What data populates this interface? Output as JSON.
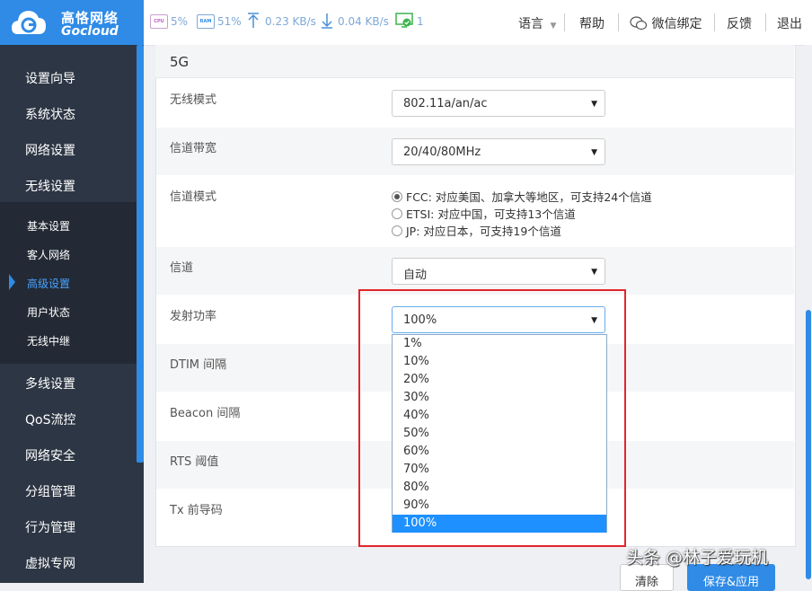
{
  "header": {
    "logo_cn": "高恪网络",
    "logo_en": "Gocloud",
    "cpu_label": "CPU",
    "cpu_value": "5%",
    "ram_label": "RAM",
    "ram_value": "51%",
    "upload": "0.23 KB/s",
    "download": "0.04 KB/s",
    "devices": "1",
    "menu": {
      "language": "语言",
      "help": "帮助",
      "wechat": "微信绑定",
      "feedback": "反馈",
      "logout": "退出"
    }
  },
  "sidebar": {
    "items": [
      "设置向导",
      "系统状态",
      "网络设置",
      "无线设置"
    ],
    "subitems": [
      "基本设置",
      "客人网络",
      "高级设置",
      "用户状态",
      "无线中继"
    ],
    "active_sub": "高级设置",
    "items_after": [
      "多线设置",
      "QoS流控",
      "网络安全",
      "分组管理",
      "行为管理",
      "虚拟专网"
    ]
  },
  "section": {
    "title": "5G",
    "rows": {
      "wireless_mode": {
        "label": "无线模式",
        "value": "802.11a/an/ac"
      },
      "bandwidth": {
        "label": "信道带宽",
        "value": "20/40/80MHz"
      },
      "channel_mode": {
        "label": "信道模式",
        "options": [
          {
            "text": "FCC: 对应美国、加拿大等地区，可支持24个信道",
            "checked": true
          },
          {
            "text": "ETSI: 对应中国，可支持13个信道",
            "checked": false
          },
          {
            "text": "JP: 对应日本，可支持19个信道",
            "checked": false
          }
        ]
      },
      "channel": {
        "label": "信道",
        "value": "自动"
      },
      "tx_power": {
        "label": "发射功率",
        "value": "100%"
      },
      "dtim": {
        "label": "DTIM 间隔"
      },
      "beacon": {
        "label": "Beacon 间隔"
      },
      "rts": {
        "label": "RTS 阈值"
      },
      "tx_preamble": {
        "label": "Tx 前导码"
      }
    }
  },
  "power_dropdown": {
    "options": [
      "1%",
      "10%",
      "20%",
      "30%",
      "40%",
      "50%",
      "60%",
      "70%",
      "80%",
      "90%",
      "100%"
    ],
    "selected": "100%"
  },
  "buttons": {
    "clear": "清除",
    "save": "保存&应用"
  },
  "watermark": "头条 @林子爱玩机",
  "colors": {
    "brand": "#2f8be6",
    "sidebar": "#2d3644",
    "highlight_box": "#e0262b",
    "selected_option": "#1e90ff"
  }
}
